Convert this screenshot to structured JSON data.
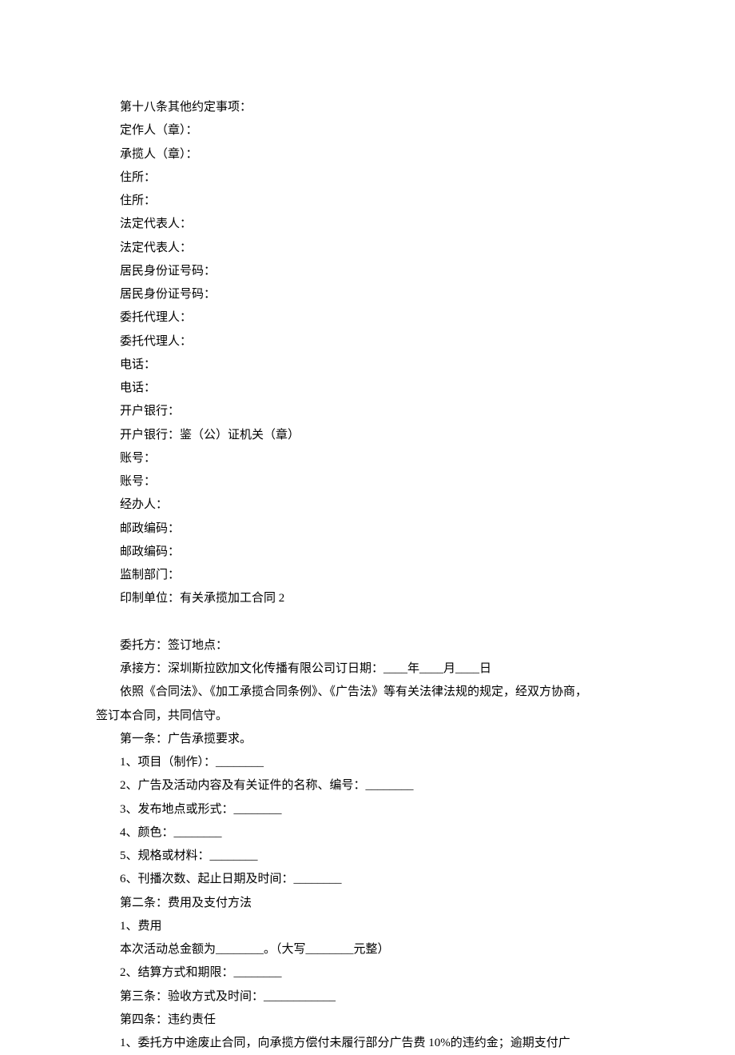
{
  "section1": {
    "lines": [
      "第十八条其他约定事项：",
      "定作人（章）：",
      "承揽人（章）：",
      "住所：",
      "住所：",
      "法定代表人：",
      "法定代表人：",
      "居民身份证号码：",
      "居民身份证号码：",
      "委托代理人：",
      "委托代理人：",
      "电话：",
      "电话：",
      "开户银行：",
      "开户银行：鉴（公）证机关（章）",
      "账号：",
      "账号：",
      "经办人：",
      "邮政编码：",
      "邮政编码：",
      "监制部门：",
      "印制单位：有关承揽加工合同 2"
    ]
  },
  "section2": {
    "lines": [
      "委托方：签订地点：",
      "承接方：深圳斯拉欧加文化传播有限公司订日期：____年____月____日",
      "依照《合同法》、《加工承揽合同条例》、《广告法》等有关法律法规的规定，经双方协商，"
    ],
    "wrapped": "签订本合同，共同信守。",
    "lines2": [
      "第一条：广告承揽要求。",
      "1、项目（制作）：________",
      "2、广告及活动内容及有关证件的名称、编号：________",
      "3、发布地点或形式：________",
      "4、颜色：________",
      "5、规格或材料：________",
      "6、刊播次数、起止日期及时间：________",
      "第二条：费用及支付方法",
      "1、费用",
      "本次活动总金额为________。（大写________元整）",
      "2、结算方式和期限：________",
      "第三条：验收方式及时间：____________",
      "第四条：违约责任",
      "1、委托方中途废止合同，向承揽方偿付未履行部分广告费 10%的违约金；逾期支付广"
    ]
  }
}
